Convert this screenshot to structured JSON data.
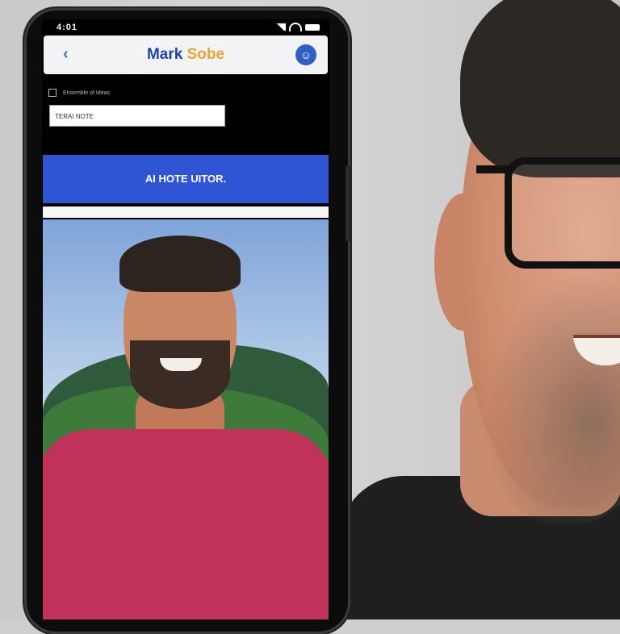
{
  "phone": {
    "status_time": "4:01",
    "app_title_main": "Mark ",
    "app_title_accent": "Sobe",
    "back_icon": "back-icon",
    "profile_icon": "profile-icon",
    "small_label": "Ensemble of Ideas",
    "field_value": "TERAI NOTE",
    "banner_text": "AI HOTE UITOR."
  },
  "colors": {
    "banner": "#2f55d4",
    "title": "#2244a8",
    "title_accent": "#e9a23a",
    "shirt_in_photo": "#c0345a"
  }
}
